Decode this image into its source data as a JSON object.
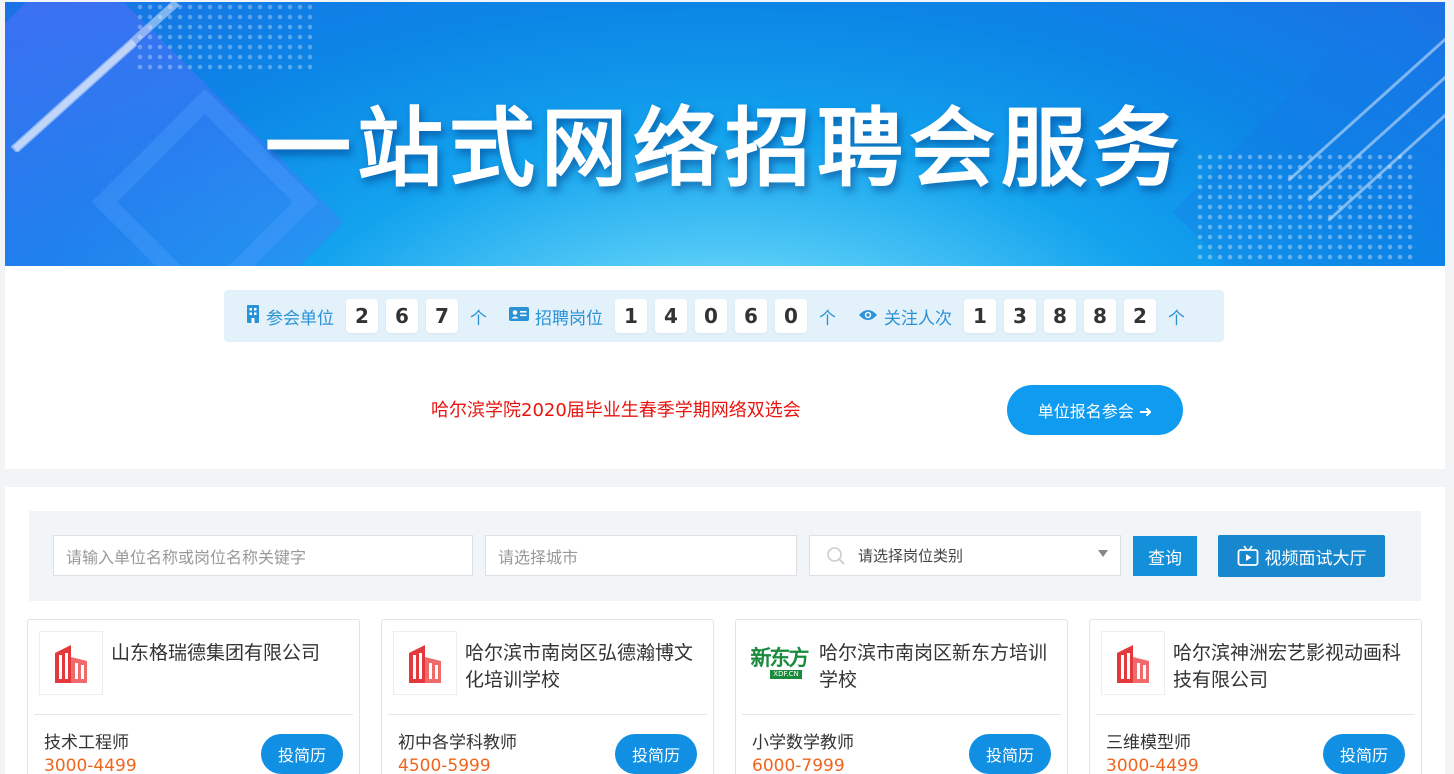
{
  "banner": {
    "title": "一站式网络招聘会服务"
  },
  "stats": [
    {
      "label": "参会单位",
      "icon": "building-icon",
      "digits": [
        "2",
        "6",
        "7"
      ],
      "unit": "个"
    },
    {
      "label": "招聘岗位",
      "icon": "id-card-icon",
      "digits": [
        "1",
        "4",
        "0",
        "6",
        "0"
      ],
      "unit": "个"
    },
    {
      "label": "关注人次",
      "icon": "eye-icon",
      "digits": [
        "1",
        "3",
        "8",
        "8",
        "2"
      ],
      "unit": "个"
    }
  ],
  "fair": {
    "title": "哈尔滨学院2020届毕业生春季学期网络双选会",
    "register_label": "单位报名参会 ➜"
  },
  "search": {
    "keyword_placeholder": "请输入单位名称或岗位名称关键字",
    "city_placeholder": "请选择城市",
    "category_placeholder": "请选择岗位类别",
    "query_label": "查询",
    "video_label": "视频面试大厅"
  },
  "cards": [
    {
      "company": "山东格瑞德集团有限公司",
      "logo": "building-logo",
      "job": "技术工程师",
      "salary": "3000-4499",
      "apply_label": "投简历"
    },
    {
      "company": "哈尔滨市南岗区弘德瀚博文化培训学校",
      "logo": "building-logo",
      "job": "初中各学科教师",
      "salary": "4500-5999",
      "apply_label": "投简历"
    },
    {
      "company": "哈尔滨市南岗区新东方培训学校",
      "logo": "xdf-logo",
      "logo_text": "新东方",
      "logo_sub": "XDF.CN",
      "job": "小学数学教师",
      "salary": "6000-7999",
      "apply_label": "投简历"
    },
    {
      "company": "哈尔滨神洲宏艺影视动画科技有限公司",
      "logo": "building-logo",
      "job": "三维模型师",
      "salary": "3000-4499",
      "apply_label": "投简历"
    }
  ],
  "colors": {
    "accent": "#1190e3",
    "salary": "#f0651d",
    "fair_title": "#e8140f",
    "stat_text": "#2a92d6"
  }
}
